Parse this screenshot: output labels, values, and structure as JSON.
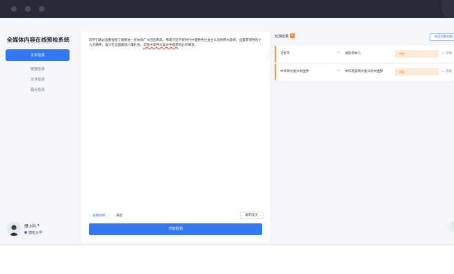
{
  "app": {
    "title": "全媒体内容在线预检系统"
  },
  "sidebar": {
    "items": [
      {
        "label": "文本检测",
        "active": true
      },
      {
        "label": "链接检测"
      },
      {
        "label": "文件检测"
      },
      {
        "label": "图片检测"
      }
    ]
  },
  "user": {
    "name": "搏小科",
    "org": "搏拓大学"
  },
  "editor": {
    "text_before": "同学们通过观看视频了解到进一步协商广大团员青年。用来习近平新时代中国特色社会主义思想伟大旗帜，全面贯彻党的十九大精神，奋斗在全面建成小康社会，",
    "text_err": "实现中华伟大复兴中国梦",
    "text_after": "的必然要求。",
    "view_example_label": "查看样例",
    "clear_label": "清空",
    "copy_all_label": "复制全文",
    "start_label": "开始检测"
  },
  "results": {
    "title": "检测结果",
    "count": "2",
    "export_label": "导出问题列表",
    "items": [
      {
        "original": "习近平",
        "arrow": "→",
        "suggestion": "规及领导人",
        "tag": "· 涉政",
        "ignore_label": "← 忽略"
      },
      {
        "original": "中华伟大复兴中国梦",
        "arrow": "→",
        "suggestion": "中华民族伟大复兴的中国梦",
        "tag": "· 涉政",
        "ignore_label": "← 忽略"
      }
    ]
  }
}
